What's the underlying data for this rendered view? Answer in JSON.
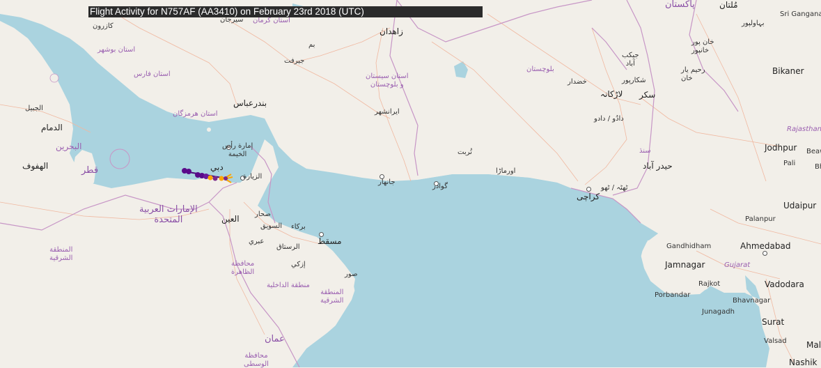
{
  "title": "Flight Activity for N757AF (AA3410) on February 23rd 2018 (UTC)",
  "colors": {
    "land": "#f2efe9",
    "water": "#aad3df",
    "border": "#c796c6",
    "road": "#f0b8a0",
    "track_start": "#4b0a7a",
    "track_end": "#ffa500"
  },
  "labels": {
    "kazerun": "کازرون",
    "sirjan": "سیرجان",
    "kerman_prov": "استان کرمان",
    "zahedan": "زاهدان",
    "bam": "بم",
    "jiroft": "جیرفت",
    "bushehr_prov": "استان بوشهر",
    "fars_prov": "استان فارس",
    "sistan_prov": "استان سیستان\nو بلوچستان",
    "iranshahr": "ایرانشهر",
    "bandar_abbas": "بندرعباس",
    "hormozgan_prov": "استان هرمزگان",
    "jubail": "الجبيل",
    "dammam": "الدمام",
    "bahrain": "البحرين",
    "qatar": "قطر",
    "hofuf": "الهفوف",
    "rak": "إمارة رأس\nالخيمة",
    "dubai": "دبي",
    "zayed": "الزيارة",
    "uae": "الإمارات العربية\nالمتحدة",
    "alain": "العين",
    "sohar": "صحار",
    "suwaiq": "السويق",
    "barka": "بركاء",
    "muscat": "مسقط",
    "ibri": "عبري",
    "rustaq": "الرستاق",
    "izki": "إزكي",
    "sur": "صور",
    "sharqiya_sa": "المنطقة\nالشرقية",
    "dhahira": "محافظة\nالظاهرة",
    "dakhiliya": "منطقة الداخلية",
    "sharqiya_om": "المنطقة\nالشرقية",
    "oman": "عمان",
    "wusta": "محافظة\nالوسطى",
    "turbat": "تُربت",
    "jiwani": "جانهار",
    "gwadar": "گوادر",
    "ormara": "اورماڑا",
    "khuzdar": "خضدار",
    "balochistan": "بلوچستان",
    "pakistan": "پاکستان",
    "multan": "مُلتان",
    "bahawalpur": "بہاولپور",
    "khanpur": "خان پور\nخانپور",
    "jacobabad": "جیکب\nآباد",
    "rahimyar": "رحیم یار\nخان",
    "shikarpur": "شکارپور",
    "larkana": "لاڑکانہ",
    "sukkur": "سکر",
    "dadu": "دادُو / دادو",
    "sindh": "سنڌ",
    "hyderabad": "حیدر آباد",
    "thatta": "ٹھٹہ / ٹھو",
    "karachi": "کراچی",
    "sri_ganganagar": "Sri Ganganagar",
    "bikaner": "Bikaner",
    "rajasthan": "Rajasthan",
    "jodhpur": "Jodhpur",
    "beawar": "Beaw",
    "pali": "Pali",
    "bhilwara": "Bhi",
    "udaipur": "Udaipur",
    "palanpur": "Palanpur",
    "gandhidham": "Gandhidham",
    "ahmedabad": "Ahmedabad",
    "jamnagar": "Jamnagar",
    "gujarat": "Gujarat",
    "rajkot": "Rajkot",
    "vadodara": "Vadodara",
    "porbandar": "Porbandar",
    "bhavnagar": "Bhavnagar",
    "junagadh": "Junagadh",
    "surat": "Surat",
    "valsad": "Valsad",
    "malegaon": "Mal",
    "nashik": "Nashik"
  },
  "track": {
    "points_count": 9
  }
}
